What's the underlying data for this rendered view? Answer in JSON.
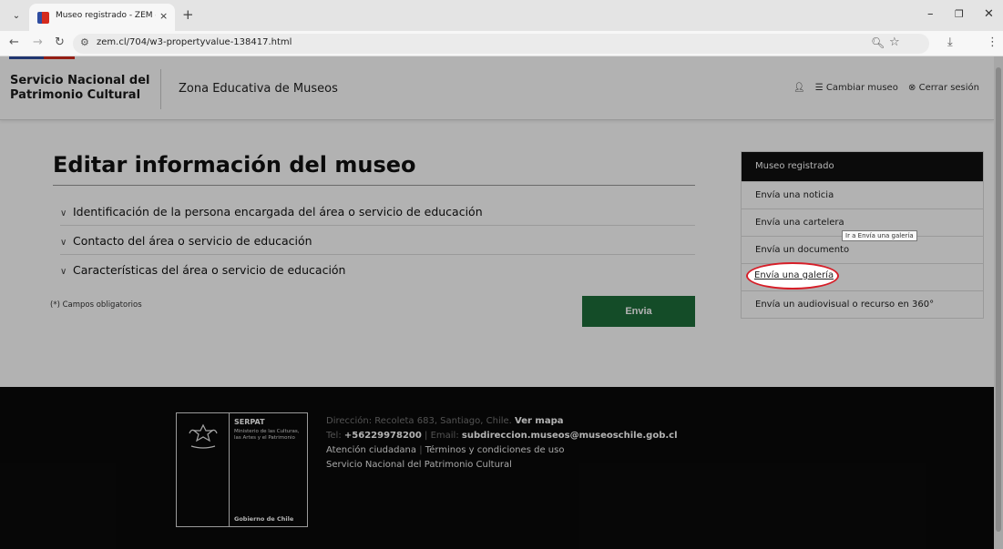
{
  "browser": {
    "tab_title": "Museo registrado - ZEM - Zona",
    "tab_close": "×",
    "new_tab": "+",
    "url": "zem.cl/704/w3-propertyvalue-138417.html",
    "window_controls": {
      "minimize": "–",
      "maximize": "❐",
      "close": "✕"
    }
  },
  "header": {
    "brand_line1": "Servicio Nacional del",
    "brand_line2": "Patrimonio Cultural",
    "zone_title": "Zona Educativa de Museos",
    "links": {
      "change_museum": "Cambiar museo",
      "logout": "Cerrar sesión"
    }
  },
  "main": {
    "title": "Editar información del museo",
    "sections": [
      {
        "label": "Identificación de la persona encargada del área o servicio de educación"
      },
      {
        "label": "Contacto del área o servicio de educación"
      },
      {
        "label": "Características del área o servicio de educación"
      }
    ],
    "required_note": "(*) Campos obligatorios",
    "submit_label": "Envia"
  },
  "sidebar": {
    "active": "Museo registrado",
    "items": [
      {
        "label": "Envía una noticia"
      },
      {
        "label": "Envía una cartelera"
      },
      {
        "label": "Envía un documento"
      },
      {
        "label": "Envía una galería"
      },
      {
        "label": "Envía un audiovisual o recurso en 360°"
      }
    ],
    "tooltip": "Ir a Envía una galería"
  },
  "footer": {
    "logo": {
      "serpat": "SERPAT",
      "ministry": "Ministerio de las Culturas, las Artes y el Patrimonio",
      "gov": "Gobierno de Chile"
    },
    "address_label": "Dirección: Recoleta 683, Santiago, Chile.",
    "map_link": "Ver mapa",
    "tel_label": "Tel:",
    "tel": "+56229978200",
    "email_label": "Email:",
    "email": "subdireccion.museos@museoschile.gob.cl",
    "citizen": "Atención ciudadana",
    "terms": "Términos y condiciones de uso",
    "org": "Servicio Nacional del Patrimonio Cultural"
  },
  "colors": {
    "accent_green": "#1e6e3a",
    "highlight_red": "#d61e28",
    "brand_blue": "#2f4da0",
    "brand_red": "#d52b1e"
  }
}
